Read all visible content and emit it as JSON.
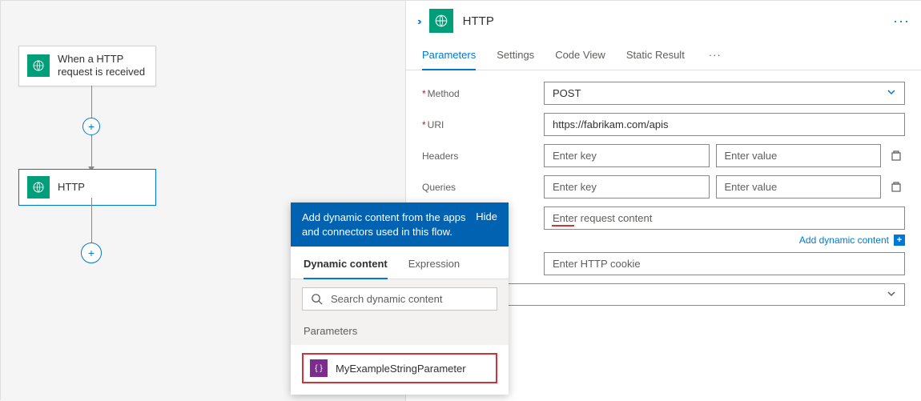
{
  "canvas": {
    "trigger_label": "When a HTTP request is received",
    "action_label": "HTTP"
  },
  "panel": {
    "title": "HTTP",
    "tabs": [
      "Parameters",
      "Settings",
      "Code View",
      "Static Result"
    ],
    "more_icon": "···",
    "fields": {
      "method_label": "Method",
      "method_value": "POST",
      "uri_label": "URI",
      "uri_value": "https://fabrikam.com/apis",
      "headers_label": "Headers",
      "queries_label": "Queries",
      "key_placeholder": "Enter key",
      "value_placeholder": "Enter value",
      "body_placeholder": "Enter request content",
      "cookie_placeholder": "Enter HTTP cookie",
      "add_dynamic_label": "Add dynamic content"
    }
  },
  "popup": {
    "help_text": "Add dynamic content from the apps and connectors used in this flow.",
    "hide_label": "Hide",
    "tabs": [
      "Dynamic content",
      "Expression"
    ],
    "search_placeholder": "Search dynamic content",
    "section_label": "Parameters",
    "param_name": "MyExampleStringParameter"
  }
}
